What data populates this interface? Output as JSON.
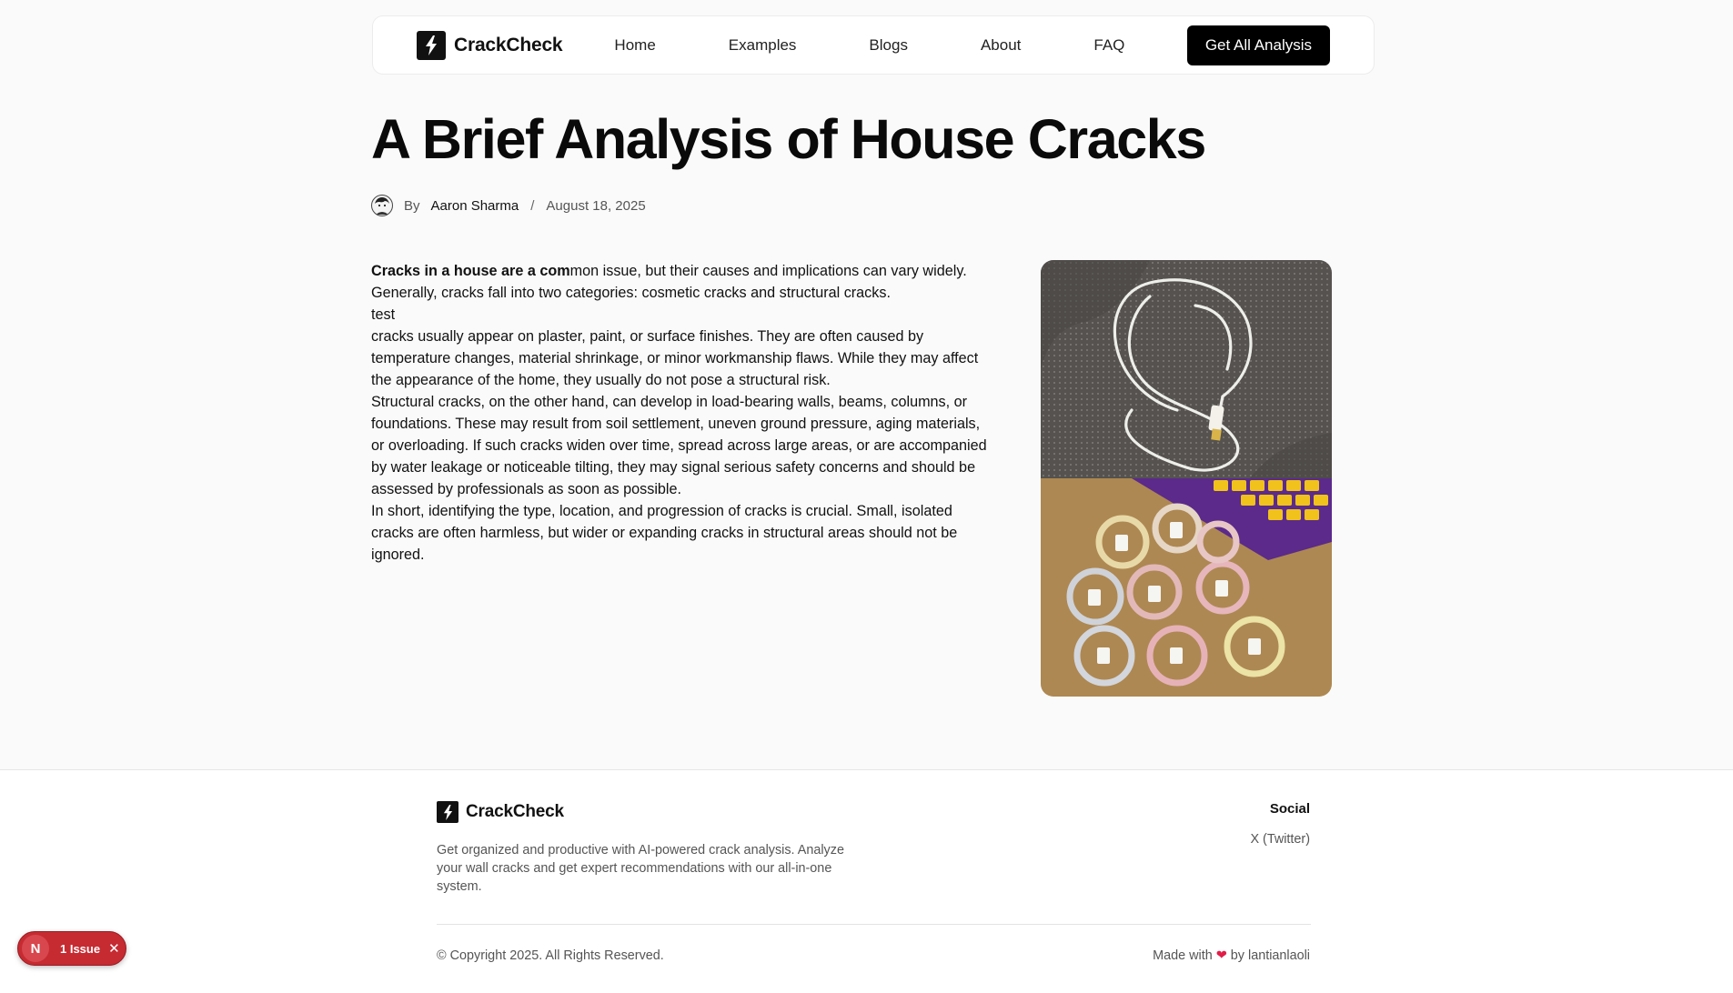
{
  "nav": {
    "brand": "CrackCheck",
    "links": [
      "Home",
      "Examples",
      "Blogs",
      "About",
      "FAQ"
    ],
    "cta": "Get All Analysis"
  },
  "post": {
    "title": "A Brief Analysis of House Cracks",
    "by": "By",
    "author": "Aaron Sharma",
    "separator": "/",
    "date": "August 18, 2025",
    "lead_bold": "Cracks in a house are a com",
    "paragraphs": [
      "mon issue, but their causes and implications can vary widely. Generally, cracks fall into two categories: cosmetic cracks and structural cracks.",
      "test",
      "cracks usually appear on plaster, paint, or surface finishes. They are often caused by temperature changes, material shrinkage, or minor workmanship flaws. While they may affect the appearance of the home, they usually do not pose a structural risk.",
      "Structural cracks, on the other hand, can develop in load-bearing walls, beams, columns, or foundations. These may result from soil settlement, uneven ground pressure, aging materials, or overloading. If such cracks widen over time, spread across large areas, or are accompanied by water leakage or noticeable tilting, they may signal serious safety concerns and should be assessed by professionals as soon as possible.",
      "In short, identifying the type, location, and progression of cracks is crucial. Small, isolated cracks are often harmless, but wider or expanding cracks in structural areas should not be ignored."
    ]
  },
  "footer": {
    "brand": "CrackCheck",
    "description": "Get organized and productive with AI-powered crack analysis. Analyze your wall cracks and get expert recommendations with our all-in-one system.",
    "social_heading": "Social",
    "social_link": "X (Twitter)",
    "copyright": "© Copyright 2025. All Rights Reserved.",
    "made_prefix": "Made with",
    "made_heart": "❤",
    "made_suffix": "by lantianlaoli"
  },
  "issue_badge": {
    "letter": "N",
    "label": "1 Issue",
    "close": "✕"
  },
  "icons": {
    "brand": "lightning-bolt-icon",
    "close": "close-icon"
  },
  "colors": {
    "accent": "#000000",
    "issue_badge": "#c62b32",
    "heart": "#e11d48"
  }
}
